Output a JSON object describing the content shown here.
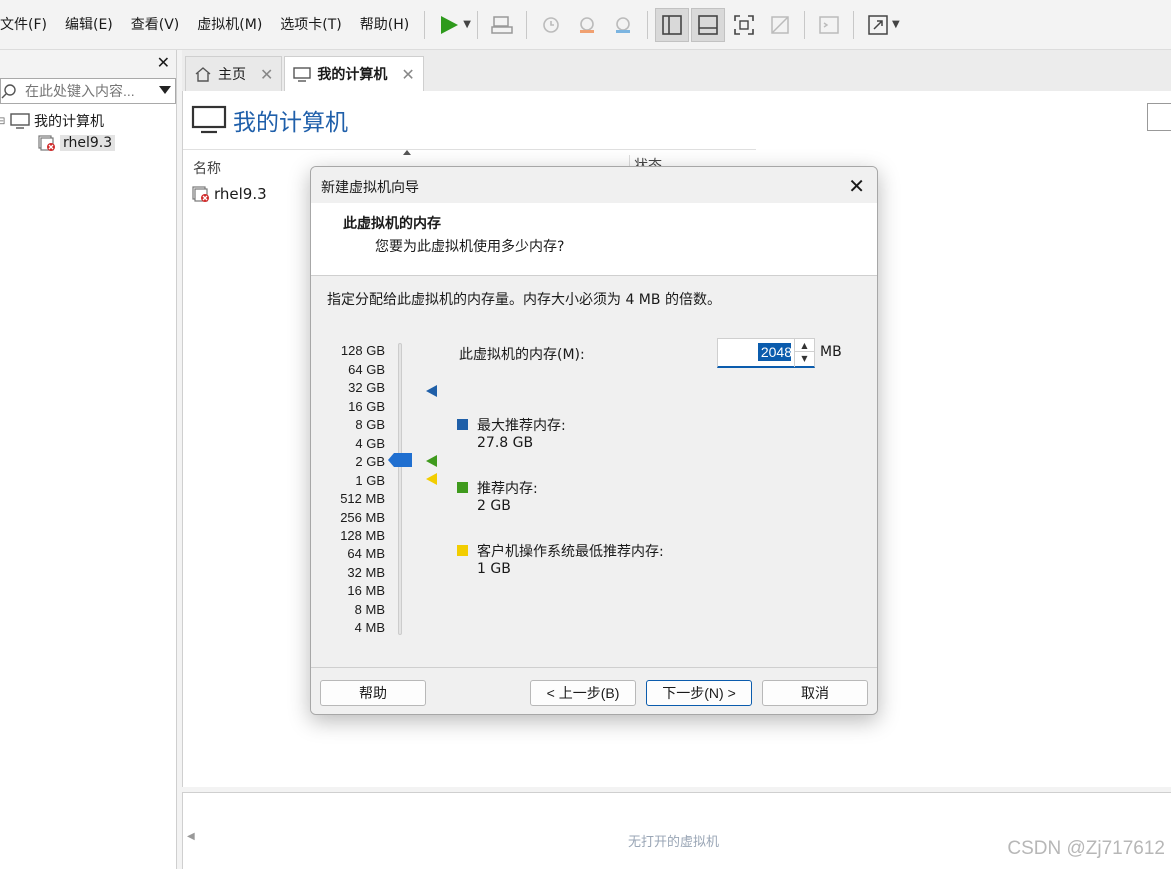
{
  "menu": [
    "文件(F)",
    "编辑(E)",
    "查看(V)",
    "虚拟机(M)",
    "选项卡(T)",
    "帮助(H)"
  ],
  "left_panel": {
    "search_placeholder": "在此处键入内容...",
    "tree_root": "我的计算机",
    "tree_child": "rhel9.3"
  },
  "tabs": [
    {
      "label": "主页"
    },
    {
      "label": "我的计算机"
    }
  ],
  "content": {
    "title": "我的计算机",
    "col_name": "名称",
    "col_status": "状态",
    "row_name": "rhel9.3"
  },
  "bottom": {
    "no_vm": "无打开的虚拟机",
    "watermark": "CSDN @Zj717612"
  },
  "dialog": {
    "title": "新建虚拟机向导",
    "heading": "此虚拟机的内存",
    "subheading": "您要为此虚拟机使用多少内存?",
    "description": "指定分配给此虚拟机的内存量。内存大小必须为 4 MB 的倍数。",
    "scale_labels": [
      "128 GB",
      "64 GB",
      "32 GB",
      "16 GB",
      "8 GB",
      "4 GB",
      "2 GB",
      "1 GB",
      "512 MB",
      "256 MB",
      "128 MB",
      "64 MB",
      "32 MB",
      "16 MB",
      "8 MB",
      "4 MB"
    ],
    "memory_label": "此虚拟机的内存(M):",
    "memory_value": "2048",
    "memory_unit": "MB",
    "legend": [
      {
        "label": "最大推荐内存:",
        "value": "27.8 GB",
        "color": "#1f5fa8"
      },
      {
        "label": "推荐内存:",
        "value": "2 GB",
        "color": "#3f9a1d"
      },
      {
        "label": "客户机操作系统最低推荐内存:",
        "value": "1 GB",
        "color": "#f2cd00"
      }
    ],
    "buttons": {
      "help": "帮助",
      "back": "< 上一步(B)",
      "next": "下一步(N) >",
      "cancel": "取消"
    }
  },
  "colors": {
    "accent": "#0b5cad",
    "title_blue": "#1f5faa"
  }
}
